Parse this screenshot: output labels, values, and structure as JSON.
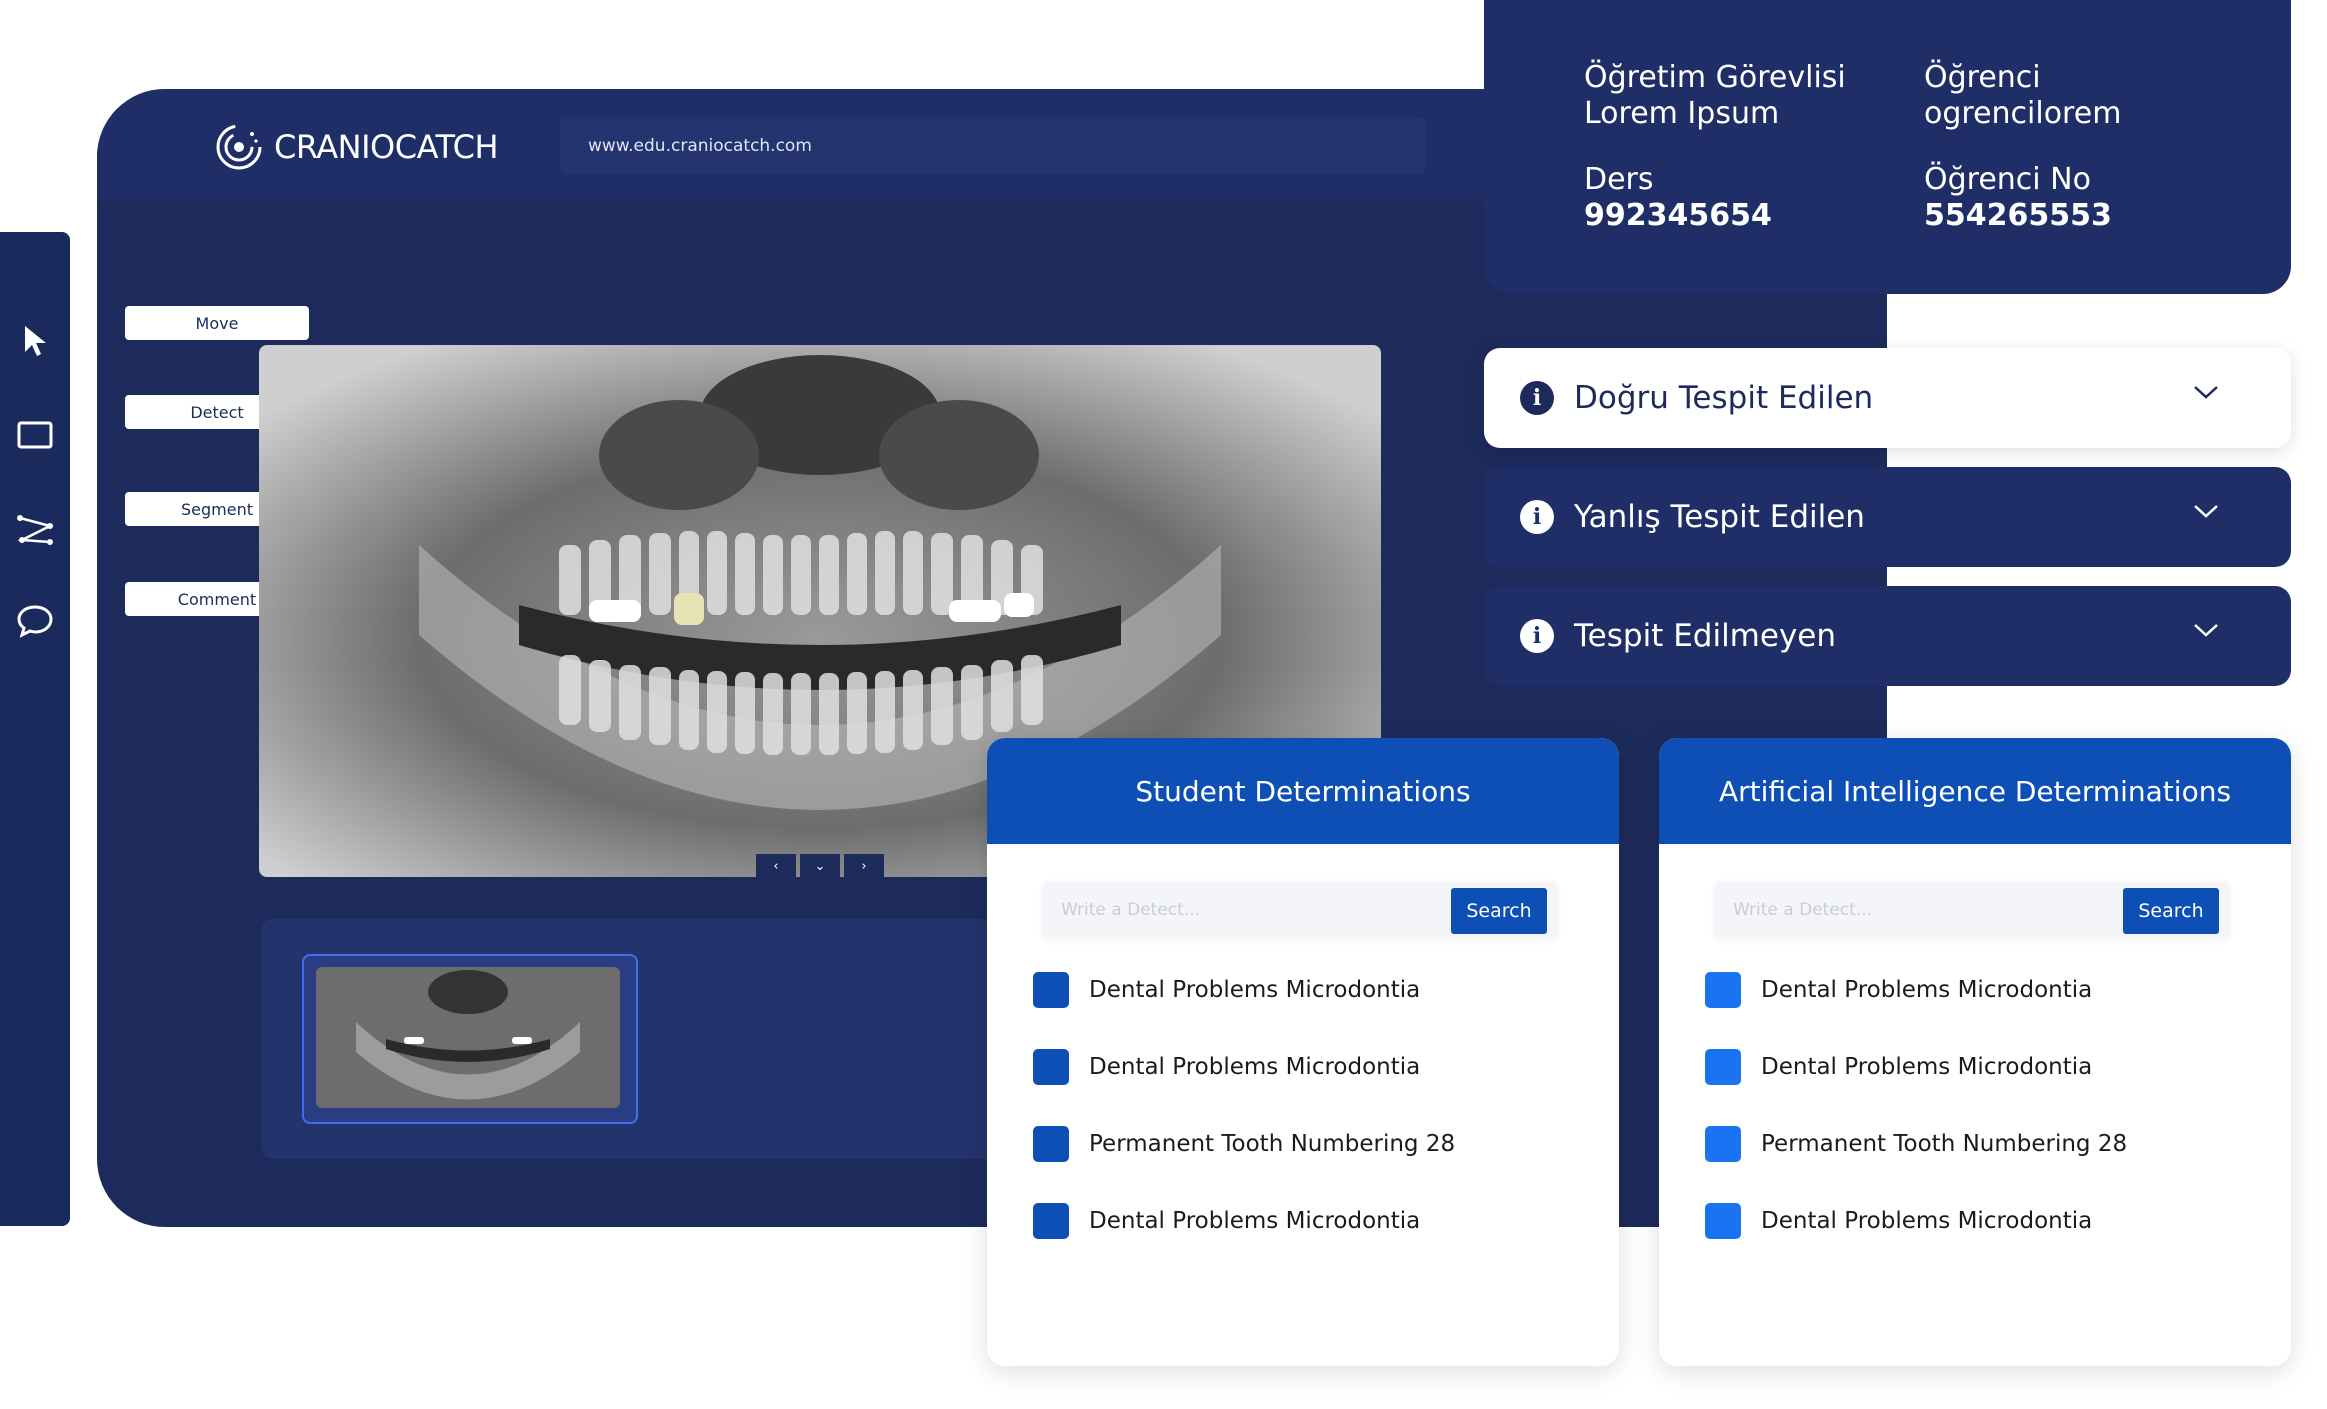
{
  "app": {
    "logo_text": "CRANIOCATCH",
    "url": "www.edu.craniocatch.com"
  },
  "tools": {
    "labels": [
      "Move",
      "Detect",
      "Segment",
      "Comment"
    ],
    "icons": [
      "cursor-icon",
      "rectangle-icon",
      "polyline-icon",
      "speech-bubble-icon"
    ]
  },
  "info": {
    "instructor_label": "Öğretim Görevlisi",
    "instructor_value": "Lorem Ipsum",
    "student_label": "Öğrenci",
    "student_value": "ogrencilorem",
    "course_label": "Ders",
    "course_value": "992345654",
    "student_no_label": "Öğrenci No",
    "student_no_value": "554265553"
  },
  "accordions": [
    {
      "title": "Doğru Tespit Edilen"
    },
    {
      "title": "Yanlış Tespit Edilen"
    },
    {
      "title": "Tespit Edilmeyen"
    }
  ],
  "student_panel": {
    "title": "Student Determinations",
    "placeholder": "Write a Detect...",
    "search_label": "Search",
    "square_color": "#0d4fb5",
    "items": [
      "Dental Problems Microdontia",
      "Dental Problems Microdontia",
      "Permanent Tooth Numbering 28",
      "Dental Problems Microdontia"
    ]
  },
  "ai_panel": {
    "title": "Artificial Intelligence Determinations",
    "placeholder": "Write a Detect...",
    "search_label": "Search",
    "square_color": "#1a73f0",
    "items": [
      "Dental Problems Microdontia",
      "Dental Problems Microdontia",
      "Permanent Tooth Numbering 28",
      "Dental Problems Microdontia"
    ]
  }
}
